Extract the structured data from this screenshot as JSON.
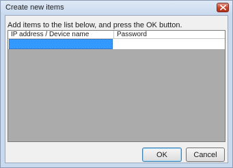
{
  "window": {
    "title": "Create new items",
    "close_icon": "close-icon"
  },
  "instruction": "Add items to the list below, and press the OK button.",
  "list": {
    "columns": [
      "IP address / Device name",
      "Password"
    ],
    "rows": [
      {
        "ip_device": "",
        "password": "",
        "selected": true
      }
    ]
  },
  "buttons": {
    "ok_label": "OK",
    "cancel_label": "Cancel"
  },
  "colors": {
    "selection": "#3399ff",
    "list_background": "#ababab",
    "close_button": "#c6442b"
  }
}
